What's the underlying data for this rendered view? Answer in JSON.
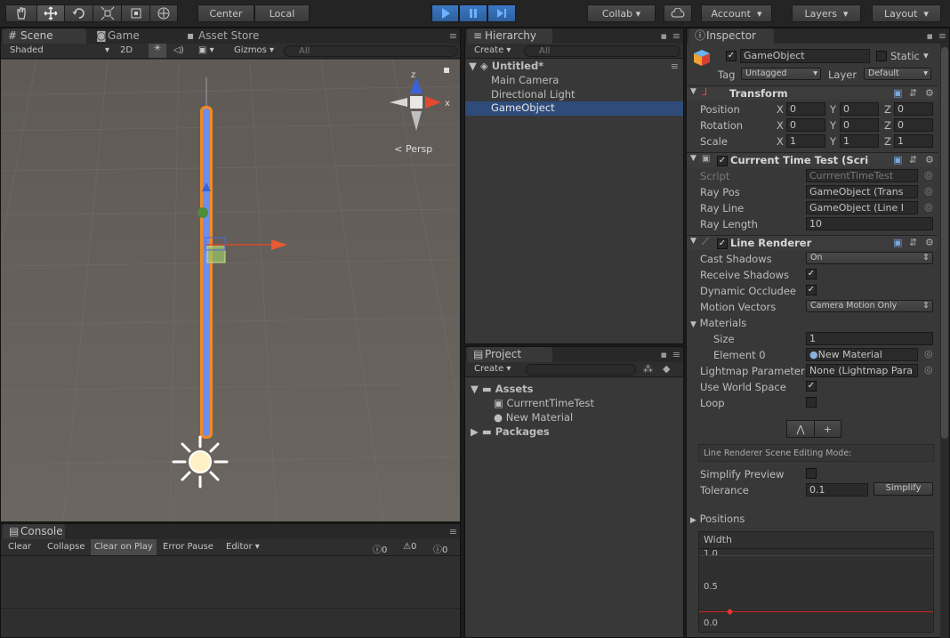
{
  "toolbar": {
    "tools": [
      "hand-icon",
      "move-icon",
      "rotate-icon",
      "scale-icon",
      "rect-icon",
      "transform-icon"
    ],
    "pivot_center": "Center",
    "pivot_local": "Local",
    "collab": "Collab",
    "account": "Account",
    "layers": "Layers",
    "layout": "Layout"
  },
  "scene": {
    "tab_scene": "Scene",
    "tab_game": "Game",
    "tab_asset_store": "Asset Store",
    "shading": "Shaded",
    "mode_2d": "2D",
    "gizmos": "Gizmos",
    "search_placeholder": "All",
    "persp_label": "Persp",
    "gizmo_y": "z",
    "gizmo_x": "x"
  },
  "hierarchy": {
    "tab": "Hierarchy",
    "create": "Create",
    "search_placeholder": "All",
    "scene_name": "Untitled*",
    "items": [
      "Main Camera",
      "Directional Light",
      "GameObject"
    ],
    "selected_index": 2
  },
  "project": {
    "tab": "Project",
    "create": "Create",
    "assets": "Assets",
    "items": [
      "CurrrentTimeTest",
      "New Material"
    ],
    "packages": "Packages"
  },
  "console": {
    "tab": "Console",
    "clear": "Clear",
    "collapse": "Collapse",
    "clear_on_play": "Clear on Play",
    "error_pause": "Error Pause",
    "editor": "Editor",
    "count_log": "0",
    "count_warn": "0",
    "count_err": "0"
  },
  "inspector": {
    "tab": "Inspector",
    "object_name": "GameObject",
    "static_label": "Static",
    "tag_label": "Tag",
    "tag_value": "Untagged",
    "layer_label": "Layer",
    "layer_value": "Default",
    "transform": {
      "title": "Transform",
      "position_label": "Position",
      "rotation_label": "Rotation",
      "scale_label": "Scale",
      "position": [
        "0",
        "0",
        "0"
      ],
      "rotation": [
        "0",
        "0",
        "0"
      ],
      "scale": [
        "1",
        "1",
        "1"
      ],
      "axis_x": "X",
      "axis_y": "Y",
      "axis_z": "Z"
    },
    "script_comp": {
      "title": "Currrent Time Test (Scri",
      "script_label": "Script",
      "script_value": "CurrrentTimeTest",
      "ray_pos_label": "Ray Pos",
      "ray_pos_value": "GameObject (Trans",
      "ray_line_label": "Ray Line",
      "ray_line_value": "GameObject (Line I",
      "ray_length_label": "Ray Length",
      "ray_length_value": "10"
    },
    "line_renderer": {
      "title": "Line Renderer",
      "cast_shadows_label": "Cast Shadows",
      "cast_shadows_value": "On",
      "receive_shadows_label": "Receive Shadows",
      "dynamic_occludee_label": "Dynamic Occludee",
      "motion_vectors_label": "Motion Vectors",
      "motion_vectors_value": "Camera Motion Only",
      "materials_label": "Materials",
      "size_label": "Size",
      "size_value": "1",
      "element0_label": "Element 0",
      "element0_value": "New Material",
      "lightmap_label": "Lightmap Parameter",
      "lightmap_value": "None (Lightmap Para",
      "world_space_label": "Use World Space",
      "loop_label": "Loop",
      "edit_mode_label": "Line Renderer Scene Editing Mode:",
      "simplify_preview_label": "Simplify Preview",
      "tolerance_label": "Tolerance",
      "tolerance_value": "0.1",
      "simplify_button": "Simplify",
      "positions_label": "Positions",
      "width_label": "Width",
      "width_ticks": [
        "1.0",
        "0.5",
        "0.0"
      ]
    }
  },
  "colors": {
    "accent_blue": "#3d78c8",
    "selection": "#2e4b7a",
    "line_orange": "#f08a24",
    "line_blue": "#6d8ef0",
    "scene_bg": "#6e6a66"
  }
}
